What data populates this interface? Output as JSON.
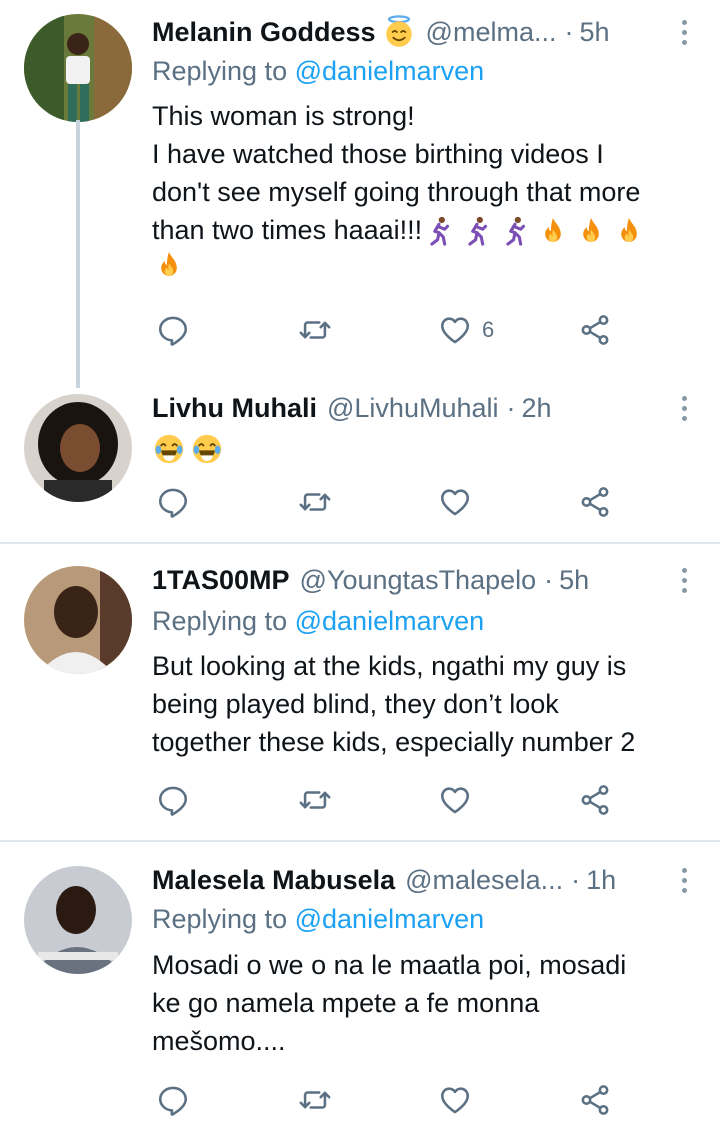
{
  "replies": [
    {
      "name": "Melanin  Goddess",
      "name_emoji": "smiling-halo-emoji",
      "handle": "@melma...",
      "time": "5h",
      "replying_prefix": "Replying to",
      "replying_to": "@danielmarven",
      "body_lines": [
        "This woman is strong!",
        "I have watched those birthing videos I",
        "don't see myself going through that more",
        "than two times haaai!!!"
      ],
      "trailing_emojis": [
        "running-woman-emoji",
        "running-woman-emoji",
        "running-woman-emoji",
        "fire-emoji",
        "fire-emoji",
        "fire-emoji",
        "fire-emoji"
      ],
      "like_count": "6"
    },
    {
      "name": "Livhu Muhali",
      "handle": "@LivhuMuhali",
      "time": "2h",
      "body_emojis": [
        "tears-of-joy-emoji",
        "tears-of-joy-emoji"
      ]
    },
    {
      "name": "1TAS00MP",
      "handle": "@YoungtasThapelo",
      "time": "5h",
      "replying_prefix": "Replying to",
      "replying_to": "@danielmarven",
      "body_lines": [
        "But looking at the kids, ngathi my guy is",
        "being played blind, they don’t look",
        "together these kids, especially number 2"
      ]
    },
    {
      "name": "Malesela Mabusela",
      "handle": "@malesela...",
      "time": "1h",
      "replying_prefix": "Replying to",
      "replying_to": "@danielmarven",
      "body_lines": [
        "Mosadi o we o na le maatla poi, mosadi",
        "ke go namela mpete a fe monna",
        "mešomo...."
      ]
    }
  ],
  "dot_separator": "·",
  "colors": {
    "text": "#0f1419",
    "secondary": "#5b7083",
    "accent": "#1da1f2",
    "divider": "#e1e8ed",
    "icon": "#5b7083"
  }
}
